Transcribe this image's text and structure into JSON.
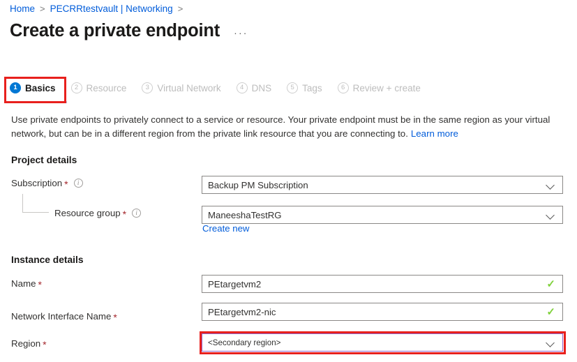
{
  "breadcrumb": {
    "items": [
      {
        "label": "Home"
      },
      {
        "label": "PECRRtestvault | Networking"
      }
    ],
    "separator": ">"
  },
  "header": {
    "title": "Create a private endpoint",
    "ellipsis": "···"
  },
  "tabs": [
    {
      "num": "1",
      "label": "Basics",
      "state": "active"
    },
    {
      "num": "2",
      "label": "Resource",
      "state": "disabled"
    },
    {
      "num": "3",
      "label": "Virtual Network",
      "state": "disabled"
    },
    {
      "num": "4",
      "label": "DNS",
      "state": "disabled"
    },
    {
      "num": "5",
      "label": "Tags",
      "state": "disabled"
    },
    {
      "num": "6",
      "label": "Review + create",
      "state": "disabled"
    }
  ],
  "description": {
    "text": "Use private endpoints to privately connect to a service or resource. Your private endpoint must be in the same region as your virtual network, but can be in a different region from the private link resource that you are connecting to.",
    "link": "Learn more"
  },
  "project_details": {
    "heading": "Project details",
    "subscription": {
      "label": "Subscription",
      "required": "*",
      "value": "Backup PM Subscription",
      "icon": "chevron-down-icon",
      "info": "i"
    },
    "resource_group": {
      "label": "Resource group",
      "required": "*",
      "value": "ManeeshaTestRG",
      "icon": "chevron-down-icon",
      "info": "i",
      "create_new": "Create new"
    }
  },
  "instance_details": {
    "heading": "Instance details",
    "name": {
      "label": "Name",
      "required": "*",
      "value": "PEtargetvm2",
      "status": "✓"
    },
    "network_interface_name": {
      "label": "Network Interface Name",
      "required": "*",
      "value": "PEtargetvm2-nic",
      "status": "✓"
    },
    "region": {
      "label": "Region",
      "required": "*",
      "value": "<Secondary region>",
      "icon": "chevron-down-icon"
    }
  },
  "annotations": {
    "color": "#e8201d",
    "targets": [
      "basics-tab",
      "region-dropdown"
    ]
  }
}
